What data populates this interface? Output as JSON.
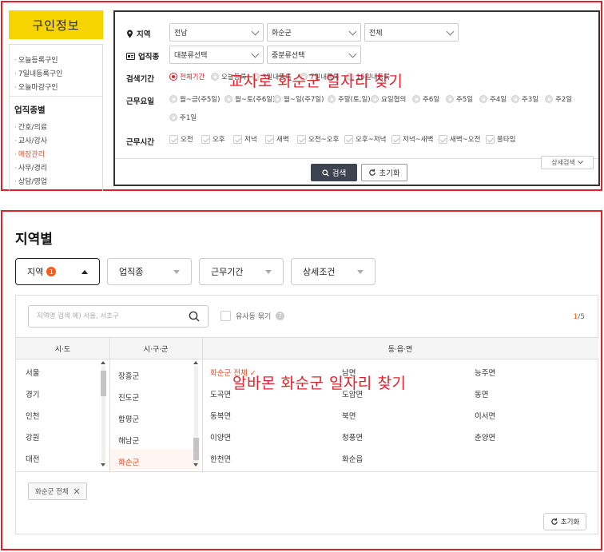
{
  "panel1": {
    "logo": "구인정보",
    "sidebar": {
      "items_top": [
        "오늘등록구인",
        "7일내등록구인",
        "오늘마감구인"
      ],
      "heading": "업직종별",
      "items": [
        "간호/의료",
        "교사/강사",
        "매장관리",
        "사무/경리",
        "상담/영업"
      ]
    },
    "filter": {
      "region_label": "지역",
      "region_values": [
        "전남",
        "화순군",
        "전체"
      ],
      "job_label": "업직종",
      "job_values": [
        "대분류선택",
        "중분류선택"
      ],
      "period_label": "검색기간",
      "period_options": [
        "전체기간",
        "오늘등록",
        "3일내등록",
        "7일내등록",
        "15일내등록"
      ],
      "days_label": "근무요일",
      "days_options": [
        "월~금(주5일)",
        "월~토(주6일)",
        "월~일(주7일)",
        "주말(토,일)",
        "요일협의",
        "주6일",
        "주5일",
        "주4일",
        "주3일",
        "주2일",
        "주1일"
      ],
      "hours_label": "근무시간",
      "hours_options": [
        "오전",
        "오후",
        "저녁",
        "새벽",
        "오전~오후",
        "오후~저녁",
        "저녁~새벽",
        "새벽~오전",
        "풀타임"
      ],
      "search_btn": "검색",
      "reset_btn": "초기화",
      "detail_btn": "상세검색"
    },
    "caption": "교차로 화순군 일자리 찾기"
  },
  "panel2": {
    "title": "지역별",
    "dropdowns": [
      {
        "label": "지역",
        "badge": "1"
      },
      {
        "label": "업직종"
      },
      {
        "label": "근무기간"
      },
      {
        "label": "상세조건"
      }
    ],
    "search_placeholder": "지역명 검색 예) 서울, 서초구",
    "similar_label": "유사동 묶기",
    "pager_current": "1",
    "pager_total": "/5",
    "col_heads": [
      "시·도",
      "시·구·군",
      "동·읍·면"
    ],
    "sido": [
      "서울",
      "경기",
      "인천",
      "강원",
      "대전"
    ],
    "sigungu": [
      "장흥군",
      "진도군",
      "함평군",
      "해남군",
      "화순군"
    ],
    "dong": [
      [
        "화순군 전체 ✓",
        "남면",
        "능주면"
      ],
      [
        "도곡면",
        "도암면",
        "동면"
      ],
      [
        "동복면",
        "북면",
        "이서면"
      ],
      [
        "이양면",
        "청풍면",
        "춘양면"
      ],
      [
        "한천면",
        "화순읍",
        ""
      ]
    ],
    "chip": "화순군 전체",
    "reset": "초기화",
    "caption": "알바몬 화순군 일자리 찾기"
  },
  "colors": {
    "accent": "#e0202a",
    "brand_yellow": "#f6d400",
    "orange": "#ff5a14"
  }
}
